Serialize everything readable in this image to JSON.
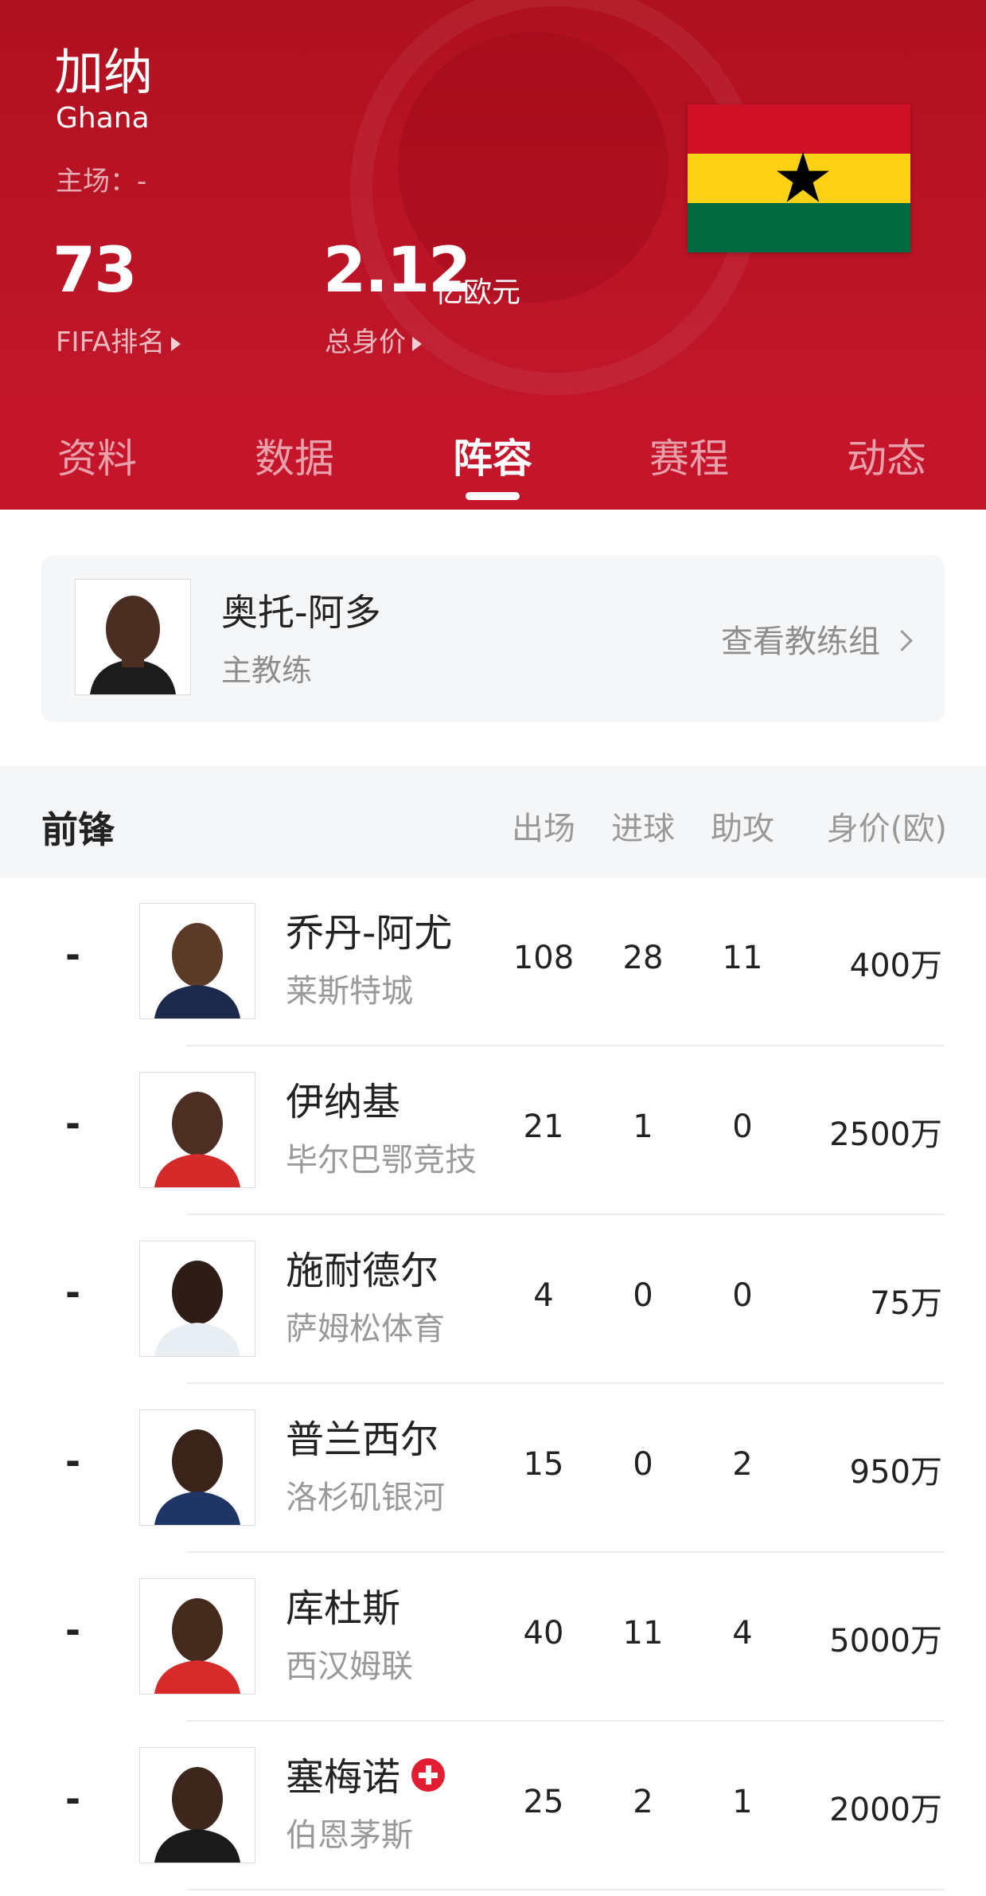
{
  "header": {
    "team_name": "加纳",
    "team_name_en": "Ghana",
    "home": "主场：-",
    "fifa_rank_value": "73",
    "fifa_rank_label": "FIFA排名",
    "market_value": "2.12",
    "market_value_unit": "亿欧元",
    "market_value_label": "总身价",
    "flag_colors": [
      "#ce1126",
      "#fcd116",
      "#006b3f"
    ]
  },
  "tabs": [
    {
      "label": "资料"
    },
    {
      "label": "数据"
    },
    {
      "label": "阵容",
      "active": true
    },
    {
      "label": "赛程"
    },
    {
      "label": "动态"
    }
  ],
  "coach": {
    "name": "奥托-阿多",
    "role": "主教练",
    "link": "查看教练组"
  },
  "section": {
    "title": "前锋",
    "columns": [
      "出场",
      "进球",
      "助攻",
      "身价(欧)"
    ]
  },
  "players": [
    {
      "number": "-",
      "name": "乔丹-阿尤",
      "club": "莱斯特城",
      "apps": "108",
      "goals": "28",
      "assists": "11",
      "value": "400万"
    },
    {
      "number": "-",
      "name": "伊纳基",
      "club": "毕尔巴鄂竞技",
      "apps": "21",
      "goals": "1",
      "assists": "0",
      "value": "2500万"
    },
    {
      "number": "-",
      "name": "施耐德尔",
      "club": "萨姆松体育",
      "apps": "4",
      "goals": "0",
      "assists": "0",
      "value": "75万"
    },
    {
      "number": "-",
      "name": "普兰西尔",
      "club": "洛杉矶银河",
      "apps": "15",
      "goals": "0",
      "assists": "2",
      "value": "950万"
    },
    {
      "number": "-",
      "name": "库杜斯",
      "club": "西汉姆联",
      "apps": "40",
      "goals": "11",
      "assists": "4",
      "value": "5000万"
    },
    {
      "number": "-",
      "name": "塞梅诺",
      "club": "伯恩茅斯",
      "apps": "25",
      "goals": "2",
      "assists": "1",
      "value": "2000万",
      "badge": "medical-cross-icon"
    }
  ],
  "colors": {
    "header_red": "#b0111f",
    "tab_red": "#c5152b",
    "muted_text": "#999999"
  }
}
